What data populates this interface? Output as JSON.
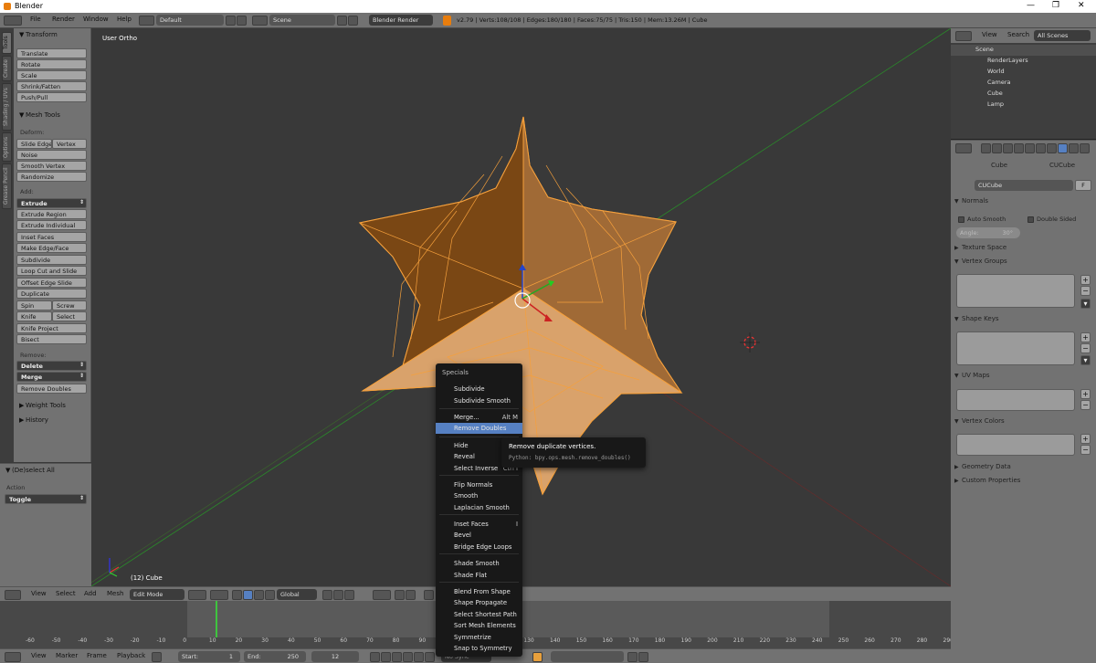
{
  "window": {
    "title": "Blender"
  },
  "window_controls": [
    "—",
    "❐",
    "✕"
  ],
  "info_header": {
    "menus": [
      "File",
      "Render",
      "Window",
      "Help"
    ],
    "layout": "Default",
    "scene": "Scene",
    "engine": "Blender Render",
    "stats": "v2.79 | Verts:108/108 | Edges:180/180 | Faces:75/75 | Tris:150 | Mem:13.26M | Cube"
  },
  "left_tabs": [
    "Tools",
    "Create",
    "Shading / UVs",
    "Options",
    "Grease Pencil"
  ],
  "tool_shelf": {
    "transform": {
      "title": "Transform",
      "buttons": [
        "Translate",
        "Rotate",
        "Scale",
        "Shrink/Fatten",
        "Push/Pull"
      ]
    },
    "mesh_tools": {
      "title": "Mesh Tools",
      "deform_label": "Deform:",
      "slide_edge": "Slide Edge",
      "vertex": "Vertex",
      "noise": "Noise",
      "smooth_vertex": "Smooth Vertex",
      "randomize": "Randomize",
      "add_label": "Add:",
      "extrude": "Extrude",
      "extrude_region": "Extrude Region",
      "extrude_individual": "Extrude Individual",
      "inset_faces": "Inset Faces",
      "make_edge_face": "Make Edge/Face",
      "subdivide": "Subdivide",
      "loop_cut": "Loop Cut and Slide",
      "offset_edge": "Offset Edge Slide",
      "duplicate": "Duplicate",
      "spin": "Spin",
      "screw": "Screw",
      "knife": "Knife",
      "select": "Select",
      "knife_project": "Knife Project",
      "bisect": "Bisect",
      "remove_label": "Remove:",
      "delete": "Delete",
      "merge": "Merge",
      "remove_doubles": "Remove Doubles"
    },
    "weight_tools": "Weight Tools",
    "history": "History"
  },
  "redo_panel": {
    "title": "(De)select All",
    "action_label": "Action",
    "action_value": "Toggle"
  },
  "viewport": {
    "view_name": "User Ortho",
    "object_label": "(12) Cube"
  },
  "viewport_header": {
    "view": "View",
    "select": "Select",
    "add": "Add",
    "mesh": "Mesh",
    "mode": "Edit Mode",
    "orientation": "Global"
  },
  "timeline": {
    "ticks": [
      "-60",
      "-50",
      "-40",
      "-30",
      "-20",
      "-10",
      "0",
      "10",
      "20",
      "30",
      "40",
      "50",
      "60",
      "70",
      "80",
      "90",
      "100",
      "110",
      "120",
      "130",
      "140",
      "150",
      "160",
      "170",
      "180",
      "190",
      "200",
      "210",
      "220",
      "230",
      "240",
      "250",
      "260",
      "270",
      "280",
      "290"
    ],
    "current_frame_marker": 12
  },
  "timeline_header": {
    "view": "View",
    "marker": "Marker",
    "frame": "Frame",
    "playback": "Playback",
    "start_label": "Start:",
    "start_value": "1",
    "end_label": "End:",
    "end_value": "250",
    "current": "12",
    "sync": "No Sync"
  },
  "outliner": {
    "tabs": [
      "View",
      "Search",
      "All Scenes"
    ],
    "items": [
      {
        "name": "Scene",
        "indent": 0
      },
      {
        "name": "RenderLayers",
        "indent": 1
      },
      {
        "name": "World",
        "indent": 1
      },
      {
        "name": "Camera",
        "indent": 1
      },
      {
        "name": "Cube",
        "indent": 1
      },
      {
        "name": "Lamp",
        "indent": 1
      }
    ]
  },
  "properties": {
    "breadcrumb_object": "Cube",
    "breadcrumb_mesh": "CUCube",
    "mesh_name": "CUCube",
    "fake_user": "F",
    "sections": {
      "normals": "Normals",
      "auto_smooth": "Auto Smooth",
      "double_sided": "Double Sided",
      "angle": "Angle:",
      "angle_value": "30°",
      "texture_space": "Texture Space",
      "vertex_groups": "Vertex Groups",
      "shape_keys": "Shape Keys",
      "uv_maps": "UV Maps",
      "vertex_colors": "Vertex Colors",
      "geometry_data": "Geometry Data",
      "custom_properties": "Custom Properties"
    }
  },
  "specials_menu": {
    "title": "Specials",
    "items": [
      {
        "label": "Subdivide",
        "shortcut": ""
      },
      {
        "label": "Subdivide Smooth",
        "shortcut": ""
      },
      {
        "label": "Merge...",
        "shortcut": "Alt M"
      },
      {
        "label": "Remove Doubles",
        "shortcut": "",
        "highlighted": true
      },
      {
        "label": "Hide",
        "shortcut": ""
      },
      {
        "label": "Reveal",
        "shortcut": ""
      },
      {
        "label": "Select Inverse",
        "shortcut": "Ctrl I"
      },
      {
        "label": "Flip Normals",
        "shortcut": ""
      },
      {
        "label": "Smooth",
        "shortcut": ""
      },
      {
        "label": "Laplacian Smooth",
        "shortcut": ""
      },
      {
        "label": "Inset Faces",
        "shortcut": "I"
      },
      {
        "label": "Bevel",
        "shortcut": ""
      },
      {
        "label": "Bridge Edge Loops",
        "shortcut": ""
      },
      {
        "label": "Shade Smooth",
        "shortcut": ""
      },
      {
        "label": "Shade Flat",
        "shortcut": ""
      },
      {
        "label": "Blend From Shape",
        "shortcut": ""
      },
      {
        "label": "Shape Propagate",
        "shortcut": ""
      },
      {
        "label": "Select Shortest Path",
        "shortcut": ""
      },
      {
        "label": "Sort Mesh Elements",
        "shortcut": ""
      },
      {
        "label": "Symmetrize",
        "shortcut": ""
      },
      {
        "label": "Snap to Symmetry",
        "shortcut": ""
      }
    ]
  },
  "tooltip": {
    "title": "Remove duplicate vertices.",
    "python": "Python: bpy.ops.mesh.remove_doubles()"
  },
  "colors": {
    "accent": "#5680c2",
    "mesh_orange": "#f5a03c",
    "ui_grey": "#727272",
    "viewport": "#393939"
  }
}
